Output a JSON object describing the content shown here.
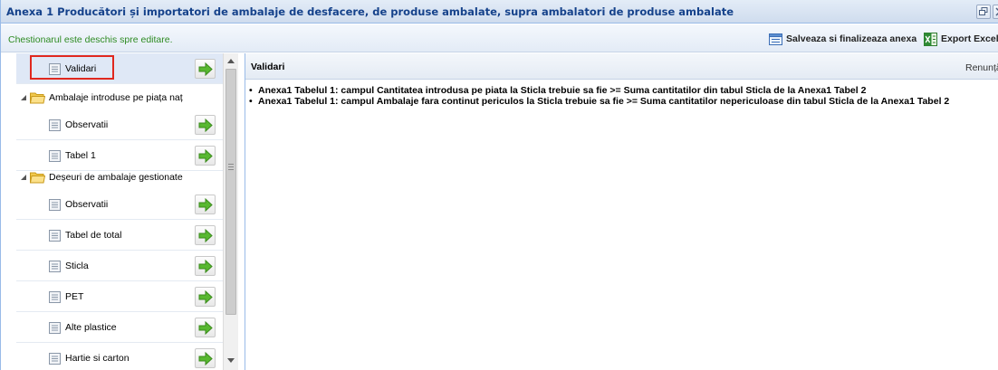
{
  "window": {
    "title": "Anexa 1 Producători și importatori de ambalaje de desfacere, de produse ambalate, supra ambalatori de produse ambalate",
    "tools": [
      "restore-icon",
      "close-icon"
    ]
  },
  "toolbar": {
    "status": "Chestionarul este deschis spre editare.",
    "status_color": "#2e8b22",
    "save_label": "Salveaza si finalizeaza anexa",
    "export_label": "Export Excel"
  },
  "sidebar": {
    "validari": {
      "label": "Validari",
      "selected": true
    },
    "groups": [
      {
        "label": "Ambalaje introduse pe piața naț",
        "items": [
          "Observatii",
          "Tabel 1"
        ]
      },
      {
        "label": "Deșeuri de ambalaje gestionate",
        "items": [
          "Observatii",
          "Tabel de total",
          "Sticla",
          "PET",
          "Alte plastice",
          "Hartie si carton"
        ]
      }
    ]
  },
  "content": {
    "title": "Validari",
    "cancel_label": "Renunță",
    "messages": [
      "Anexa1 Tabelul 1: campul Cantitatea introdusa pe piata la Sticla trebuie sa fie >= Suma cantitatilor din tabul Sticla de la Anexa1 Tabel 2",
      "Anexa1 Tabelul 1: campul Ambalaje fara continut periculos la Sticla trebuie sa fie >= Suma cantitatilor nepericuloase din tabul Sticla de la Anexa1 Tabel 2"
    ]
  },
  "colors": {
    "accent": "#15428b",
    "highlight_border": "#e0281e",
    "go_arrow": "#4caf2a"
  }
}
